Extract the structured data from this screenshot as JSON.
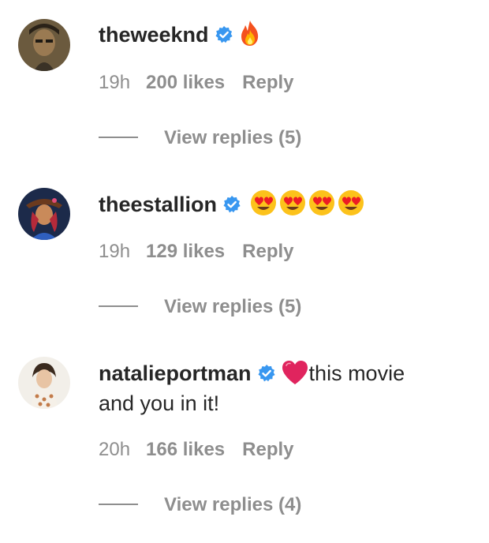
{
  "comments": [
    {
      "username": "theweeknd",
      "verified": true,
      "emoji_icons": [
        "fire-icon"
      ],
      "text": "",
      "time": "19h",
      "likes": "200 likes",
      "reply": "Reply",
      "view_replies": "View replies (5)"
    },
    {
      "username": "theestallion",
      "verified": true,
      "emoji_icons": [
        "heart-eyes-icon",
        "heart-eyes-icon",
        "heart-eyes-icon",
        "heart-eyes-icon"
      ],
      "text": "",
      "time": "19h",
      "likes": "129 likes",
      "reply": "Reply",
      "view_replies": "View replies (5)"
    },
    {
      "username": "natalieportman",
      "verified": true,
      "emoji_icons": [
        "red-heart-icon"
      ],
      "text": "this movie",
      "text_continuation": "and you in it!",
      "time": "20h",
      "likes": "166 likes",
      "reply": "Reply",
      "view_replies": "View replies (4)"
    }
  ],
  "colors": {
    "text": "#262626",
    "secondary": "#8e8e8e",
    "verified": "#3897f0",
    "heart": "#e0245e"
  }
}
